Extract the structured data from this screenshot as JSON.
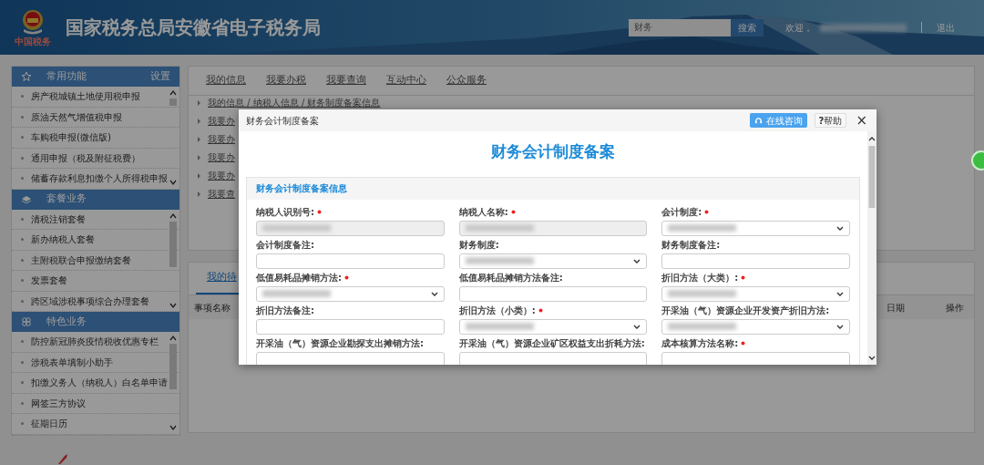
{
  "header": {
    "title": "国家税务总局安徽省电子税务局",
    "logo_text": "中国税务",
    "search_value": "财务",
    "search_button": "搜索",
    "welcome": "欢迎，",
    "logout": "退出"
  },
  "sidebar": [
    {
      "title": "常用功能",
      "action": "设置",
      "items": [
        "房产税城镇土地使用税申报",
        "原油天然气增值税申报",
        "车购税申报(微信版)",
        "通用申报（税及附征税费）",
        "储蓄存款利息扣缴个人所得税申报"
      ]
    },
    {
      "title": "套餐业务",
      "items": [
        "清税注销套餐",
        "新办纳税人套餐",
        "主附税联合申报缴纳套餐",
        "发票套餐",
        "跨区域涉税事项综合办理套餐"
      ]
    },
    {
      "title": "特色业务",
      "items": [
        "防控新冠肺炎疫情税收优惠专栏",
        "涉税表单填制小助手",
        "扣缴义务人（纳税人）白名单申请",
        "网签三方协议",
        "征期日历"
      ]
    }
  ],
  "main": {
    "tabs": [
      {
        "label": "我的信息",
        "selected": false
      },
      {
        "label": "我要办税",
        "selected": false
      },
      {
        "label": "我要查询",
        "selected": false
      },
      {
        "label": "互动中心",
        "selected": false
      },
      {
        "label": "公众服务",
        "selected": false
      }
    ],
    "links": [
      "我的信息 / 纳税人信息 / 财务制度备案信息",
      "我要办",
      "我要办",
      "我要办",
      "我要办",
      "我要查"
    ],
    "todo": {
      "tabs": [
        {
          "label": "我的待",
          "selected": true
        }
      ],
      "columns": [
        "事项名称",
        "日期",
        "操作"
      ]
    }
  },
  "modal": {
    "title": "财务会计制度备案",
    "consult_button": "在线咨询",
    "help_glyph": "?",
    "help_button": "帮助",
    "close": "×",
    "heading": "财务会计制度备案",
    "section": "财务会计制度备案信息",
    "fields": [
      {
        "label": "纳税人识别号:",
        "required": true,
        "kind": "readonly",
        "value_hidden": true
      },
      {
        "label": "纳税人名称:",
        "required": true,
        "kind": "readonly",
        "value_hidden": true
      },
      {
        "label": "会计制度:",
        "required": true,
        "kind": "select",
        "value_hidden": true
      },
      {
        "label": "会计制度备注:",
        "required": false,
        "kind": "text",
        "value_hidden": false
      },
      {
        "label": "财务制度:",
        "required": false,
        "kind": "select",
        "value_hidden": true
      },
      {
        "label": "财务制度备注:",
        "required": false,
        "kind": "text",
        "value_hidden": false
      },
      {
        "label": "低值易耗品摊销方法:",
        "required": true,
        "kind": "select",
        "value_hidden": true
      },
      {
        "label": "低值易耗品摊销方法备注:",
        "required": false,
        "kind": "text",
        "value_hidden": false
      },
      {
        "label": "折旧方法（大类）:",
        "required": true,
        "kind": "select",
        "value_hidden": true
      },
      {
        "label": "折旧方法备注:",
        "required": false,
        "kind": "text",
        "value_hidden": false
      },
      {
        "label": "折旧方法（小类）:",
        "required": true,
        "kind": "select",
        "value_hidden": true
      },
      {
        "label": "开采油（气）资源企业开发资产折旧方法:",
        "required": false,
        "kind": "select",
        "value_hidden": true
      },
      {
        "label": "开采油（气）资源企业勘探支出摊销方法:",
        "required": false,
        "kind": "text",
        "value_hidden": false
      },
      {
        "label": "开采油（气）资源企业矿区权益支出折耗方法:",
        "required": false,
        "kind": "text",
        "value_hidden": false
      },
      {
        "label": "成本核算方法名称:",
        "required": true,
        "kind": "text",
        "value_hidden": false
      }
    ]
  }
}
